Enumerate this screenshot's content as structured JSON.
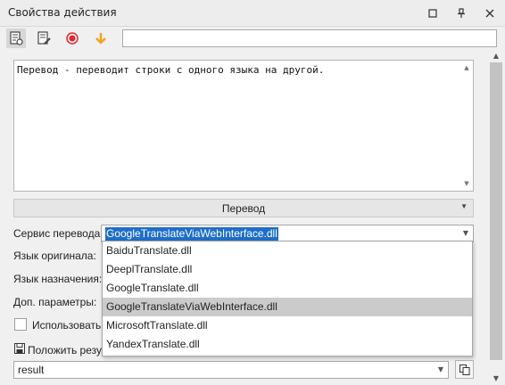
{
  "window": {
    "title": "Свойства действия",
    "controls": {
      "maximize": "□",
      "pin": "📌",
      "close": "✕"
    }
  },
  "toolbar": {
    "tools": [
      "properties-icon",
      "edit-notes-icon",
      "record-icon",
      "arrow-down-icon"
    ],
    "search_value": ""
  },
  "description": {
    "text": "Перевод - переводит строки с одного языка на другой."
  },
  "section": {
    "label": "Перевод"
  },
  "form": {
    "service_label": "Сервис перевода:",
    "service_value": "GoogleTranslateViaWebInterface.dll",
    "source_lang_label": "Язык оригинала:",
    "target_lang_label": "Язык назначения:",
    "extra_params_label": "Доп. параметры:",
    "use_label": "Использовать п",
    "save_label": "Положить резул",
    "result_value": "result"
  },
  "dropdown": {
    "options": [
      "BaiduTranslate.dll",
      "DeeplTranslate.dll",
      "GoogleTranslate.dll",
      "GoogleTranslateViaWebInterface.dll",
      "MicrosoftTranslate.dll",
      "YandexTranslate.dll"
    ],
    "selected_index": 3
  },
  "colors": {
    "selection": "#1f6ec9",
    "record_red": "#e3282f",
    "arrow_orange": "#f5a21b",
    "dropdown_highlight": "#cbcbcb"
  }
}
